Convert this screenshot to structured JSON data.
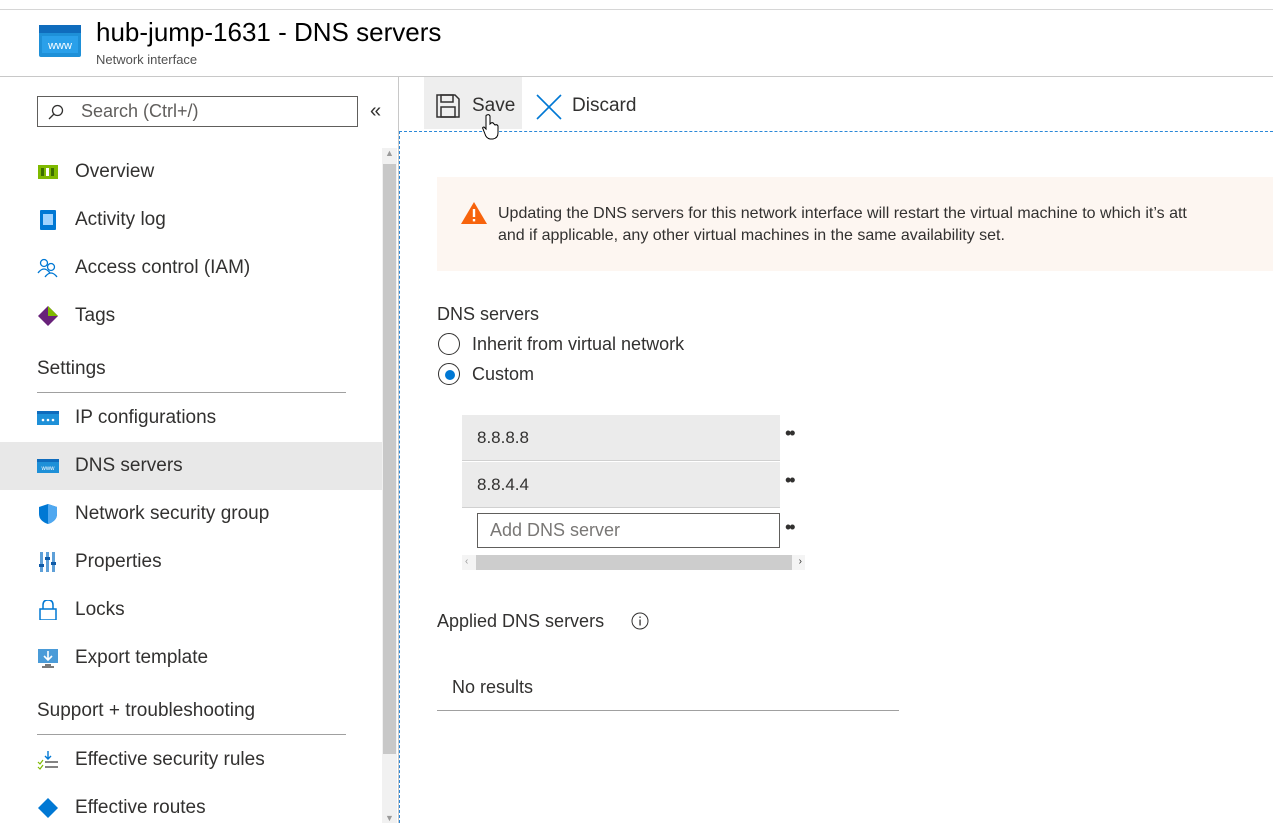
{
  "header": {
    "title": "hub-jump-1631 - DNS servers",
    "subtitle": "Network interface",
    "icon": "www-icon"
  },
  "sidebar": {
    "search_placeholder": "Search (Ctrl+/)",
    "collapse_glyph": "«",
    "items": [
      {
        "label": "Overview",
        "icon": "overview-icon"
      },
      {
        "label": "Activity log",
        "icon": "activity-log-icon"
      },
      {
        "label": "Access control (IAM)",
        "icon": "iam-icon"
      },
      {
        "label": "Tags",
        "icon": "tag-icon"
      }
    ],
    "settings_heading": "Settings",
    "settings_items": [
      {
        "label": "IP configurations",
        "icon": "ip-config-icon"
      },
      {
        "label": "DNS servers",
        "icon": "dns-icon",
        "active": true
      },
      {
        "label": "Network security group",
        "icon": "shield-icon"
      },
      {
        "label": "Properties",
        "icon": "properties-icon"
      },
      {
        "label": "Locks",
        "icon": "lock-icon"
      },
      {
        "label": "Export template",
        "icon": "export-template-icon"
      }
    ],
    "support_heading": "Support + troubleshooting",
    "support_items": [
      {
        "label": "Effective security rules",
        "icon": "security-rules-icon"
      },
      {
        "label": "Effective routes",
        "icon": "routes-icon"
      }
    ]
  },
  "toolbar": {
    "save_label": "Save",
    "discard_label": "Discard"
  },
  "warning": {
    "line1": "Updating the DNS servers for this network interface will restart the virtual machine to which it’s att",
    "line2": "and if applicable, any other virtual machines in the same availability set.",
    "color": "#f7630c"
  },
  "dns": {
    "label": "DNS servers",
    "options": [
      {
        "label": "Inherit from virtual network",
        "selected": false
      },
      {
        "label": "Custom",
        "selected": true
      }
    ],
    "servers": [
      "8.8.8.8",
      "8.8.4.4"
    ],
    "add_placeholder": "Add DNS server",
    "more_glyph": "••"
  },
  "applied": {
    "label": "Applied DNS servers",
    "empty_text": "No results"
  },
  "colors": {
    "accent": "#0078d4",
    "active_bg": "#e8e8e8",
    "warning_bg": "#fdf6f1"
  }
}
